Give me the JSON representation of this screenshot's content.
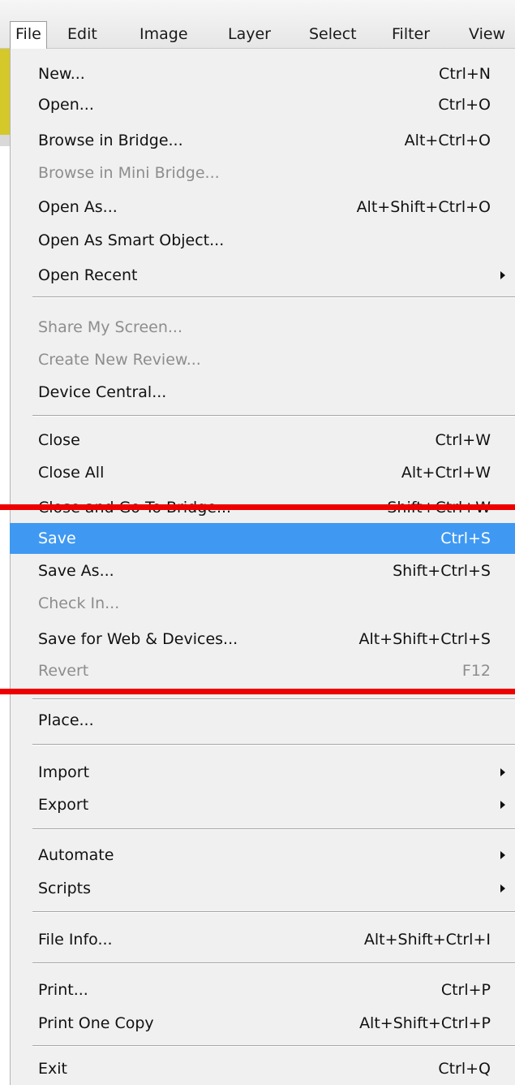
{
  "menubar": {
    "items": [
      "File",
      "Edit",
      "Image",
      "Layer",
      "Select",
      "Filter",
      "View"
    ],
    "active": "File"
  },
  "menu": {
    "items": [
      {
        "label": "New...",
        "shortcut": "Ctrl+N"
      },
      {
        "label": "Open...",
        "shortcut": "Ctrl+O"
      },
      {
        "label": "Browse in Bridge...",
        "shortcut": "Alt+Ctrl+O"
      },
      {
        "label": "Browse in Mini Bridge...",
        "shortcut": "",
        "disabled": true
      },
      {
        "label": "Open As...",
        "shortcut": "Alt+Shift+Ctrl+O"
      },
      {
        "label": "Open As Smart Object...",
        "shortcut": ""
      },
      {
        "label": "Open Recent",
        "shortcut": "",
        "submenu": true
      },
      {
        "label": "Share My Screen...",
        "shortcut": "",
        "disabled": true
      },
      {
        "label": "Create New Review...",
        "shortcut": "",
        "disabled": true
      },
      {
        "label": "Device Central...",
        "shortcut": ""
      },
      {
        "label": "Close",
        "shortcut": "Ctrl+W"
      },
      {
        "label": "Close All",
        "shortcut": "Alt+Ctrl+W"
      },
      {
        "label": "Close and Go To Bridge...",
        "shortcut": "Shift+Ctrl+W"
      },
      {
        "label": "Save",
        "shortcut": "Ctrl+S",
        "highlighted": true
      },
      {
        "label": "Save As...",
        "shortcut": "Shift+Ctrl+S"
      },
      {
        "label": "Check In...",
        "shortcut": "",
        "disabled": true
      },
      {
        "label": "Save for Web & Devices...",
        "shortcut": "Alt+Shift+Ctrl+S"
      },
      {
        "label": "Revert",
        "shortcut": "F12",
        "disabled": true
      },
      {
        "label": "Place...",
        "shortcut": ""
      },
      {
        "label": "Import",
        "shortcut": "",
        "submenu": true
      },
      {
        "label": "Export",
        "shortcut": "",
        "submenu": true
      },
      {
        "label": "Automate",
        "shortcut": "",
        "submenu": true
      },
      {
        "label": "Scripts",
        "shortcut": "",
        "submenu": true
      },
      {
        "label": "File Info...",
        "shortcut": "Alt+Shift+Ctrl+I"
      },
      {
        "label": "Print...",
        "shortcut": "Ctrl+P"
      },
      {
        "label": "Print One Copy",
        "shortcut": "Alt+Shift+Ctrl+P"
      },
      {
        "label": "Exit",
        "shortcut": "Ctrl+Q"
      }
    ]
  },
  "colors": {
    "highlight": "#3f99f2",
    "annotation_red": "#ee0000",
    "disabled_text": "#8d8d8d",
    "yellow_accent": "#d5c82a"
  }
}
